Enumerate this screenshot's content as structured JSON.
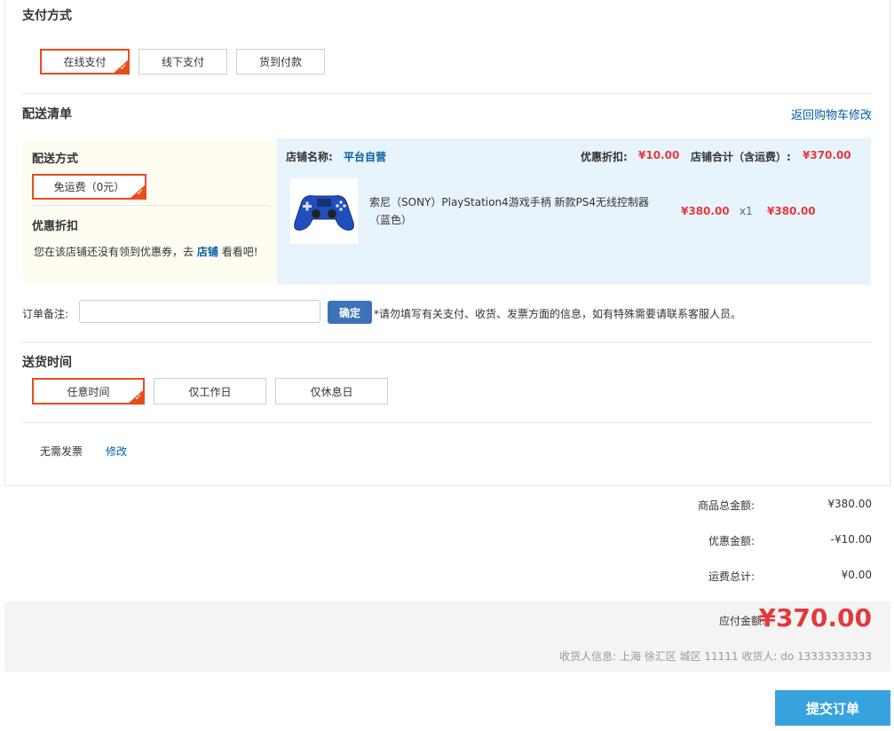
{
  "payment": {
    "title": "支付方式",
    "options": [
      "在线支付",
      "线下支付",
      "货到付款"
    ],
    "selected_index": 0
  },
  "delivery_list": {
    "title": "配送清单",
    "back_link": "返回购物车修改",
    "shipping_method_label": "配送方式",
    "shipping_option": "免运费（0元）",
    "discount_label": "优惠折扣",
    "coupon_text_before": "您在该店铺还没有领到优惠券，去",
    "coupon_link": "店铺",
    "coupon_text_after": "看看吧!",
    "store_label": "店铺名称:",
    "store_name": "平台自营",
    "store_discount_label": "优惠折扣:",
    "store_discount": "¥10.00",
    "store_total_label": "店铺合计（含运费）:",
    "store_total": "¥370.00",
    "item": {
      "name": "索尼（SONY）PlayStation4游戏手柄 新款PS4无线控制器（蓝色）",
      "price": "¥380.00",
      "qty": "x1",
      "subtotal": "¥380.00"
    }
  },
  "order_note": {
    "label": "订单备注:",
    "value": "",
    "button": "确定",
    "hint": "*请勿填写有关支付、收货、发票方面的信息，如有特殊需要请联系客服人员。"
  },
  "delivery_time": {
    "title": "送货时间",
    "options": [
      "任意时间",
      "仅工作日",
      "仅休息日"
    ],
    "selected_index": 0
  },
  "invoice": {
    "text": "无需发票",
    "edit_link": "修改"
  },
  "summary": {
    "goods_total_label": "商品总金额:",
    "goods_total": "¥380.00",
    "discount_label": "优惠金额:",
    "discount": "-¥10.00",
    "shipping_label": "运费总计:",
    "shipping": "¥0.00",
    "payable_label": "应付金额:",
    "payable": "¥370.00",
    "receiver_info": "收货人信息: 上海 徐汇区 城区 11111 收货人: do 13333333333"
  },
  "submit_button": "提交订单",
  "colors": {
    "accent_red": "#e4393c",
    "selected_border": "#e84c1e",
    "link_blue": "#005ea7",
    "submit_blue": "#37a3de"
  }
}
